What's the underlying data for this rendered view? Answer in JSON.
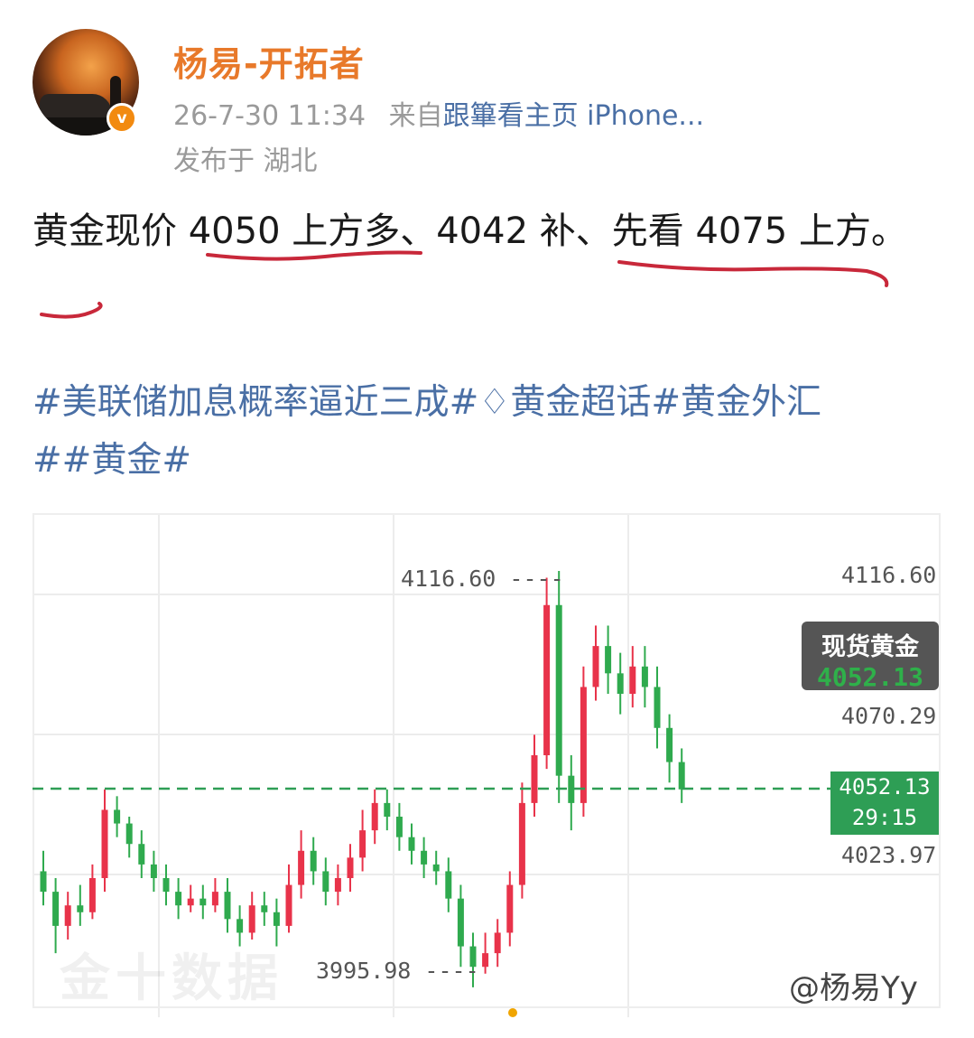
{
  "user": {
    "name": "杨易-开拓者",
    "timestamp": "26-7-30 11:34",
    "source_prefix": "来自",
    "device": "跟篳看主页 iPhone...",
    "location": "发布于 湖北",
    "verified_mark": "v"
  },
  "post": {
    "text_1": "黄金现价 ",
    "text_2": "4050 上方多",
    "text_3": "、4042 补、",
    "text_4": "先看 4075 上方",
    "text_5": "。"
  },
  "tags": {
    "line1_a": "#美联储加息概率逼近三成#",
    "diamond_icon": "♢",
    "line1_b": "黄金超话#黄金外汇",
    "line2": "##黄金#"
  },
  "chart": {
    "spot_title": "现货黄金",
    "spot_value": "4052.13",
    "current_price": "4052.13",
    "countdown": "29:15",
    "peak_label": "4116.60",
    "low_label": "3995.98",
    "watermark": "金十数据",
    "handle": "@杨易Yy",
    "colors": {
      "up": "#e8334a",
      "down": "#2faa4e",
      "current_line": "#2e9e55"
    }
  },
  "chart_data": {
    "type": "candlestick",
    "y_ticks": [
      "4116.60",
      "4070.29",
      "4023.97"
    ],
    "ylim": [
      3990,
      4125
    ],
    "candles": [
      [
        4028,
        4022,
        4034,
        4018
      ],
      [
        4022,
        4012,
        4026,
        4004
      ],
      [
        4012,
        4018,
        4022,
        4008
      ],
      [
        4018,
        4016,
        4024,
        4012
      ],
      [
        4016,
        4026,
        4030,
        4014
      ],
      [
        4026,
        4046,
        4052,
        4022
      ],
      [
        4046,
        4042,
        4050,
        4038
      ],
      [
        4042,
        4036,
        4044,
        4032
      ],
      [
        4036,
        4030,
        4040,
        4026
      ],
      [
        4030,
        4026,
        4034,
        4022
      ],
      [
        4026,
        4022,
        4030,
        4018
      ],
      [
        4022,
        4018,
        4026,
        4014
      ],
      [
        4018,
        4020,
        4024,
        4016
      ],
      [
        4020,
        4018,
        4024,
        4014
      ],
      [
        4018,
        4022,
        4026,
        4016
      ],
      [
        4022,
        4014,
        4026,
        4010
      ],
      [
        4014,
        4010,
        4018,
        4006
      ],
      [
        4010,
        4018,
        4022,
        4008
      ],
      [
        4018,
        4016,
        4022,
        4012
      ],
      [
        4016,
        4012,
        4020,
        4006
      ],
      [
        4012,
        4024,
        4030,
        4010
      ],
      [
        4024,
        4034,
        4040,
        4020
      ],
      [
        4034,
        4028,
        4038,
        4024
      ],
      [
        4028,
        4022,
        4032,
        4018
      ],
      [
        4022,
        4026,
        4030,
        4018
      ],
      [
        4026,
        4032,
        4036,
        4022
      ],
      [
        4032,
        4040,
        4046,
        4028
      ],
      [
        4040,
        4048,
        4052,
        4036
      ],
      [
        4048,
        4044,
        4052,
        4040
      ],
      [
        4044,
        4038,
        4048,
        4034
      ],
      [
        4038,
        4034,
        4042,
        4030
      ],
      [
        4034,
        4030,
        4038,
        4026
      ],
      [
        4030,
        4028,
        4034,
        4024
      ],
      [
        4028,
        4020,
        4032,
        4016
      ],
      [
        4020,
        4006,
        4024,
        4000
      ],
      [
        4006,
        4000,
        4010,
        3994
      ],
      [
        4000,
        4004,
        4010,
        3998
      ],
      [
        4004,
        4010,
        4014,
        4000
      ],
      [
        4010,
        4024,
        4028,
        4006
      ],
      [
        4024,
        4048,
        4054,
        4020
      ],
      [
        4048,
        4062,
        4068,
        4044
      ],
      [
        4062,
        4106,
        4114,
        4058
      ],
      [
        4106,
        4056,
        4116,
        4048
      ],
      [
        4056,
        4048,
        4062,
        4040
      ],
      [
        4048,
        4082,
        4088,
        4044
      ],
      [
        4082,
        4094,
        4100,
        4078
      ],
      [
        4094,
        4086,
        4100,
        4080
      ],
      [
        4086,
        4080,
        4092,
        4074
      ],
      [
        4080,
        4088,
        4094,
        4076
      ],
      [
        4088,
        4082,
        4094,
        4076
      ],
      [
        4082,
        4070,
        4088,
        4064
      ],
      [
        4070,
        4060,
        4074,
        4054
      ],
      [
        4060,
        4052,
        4064,
        4048
      ]
    ]
  }
}
